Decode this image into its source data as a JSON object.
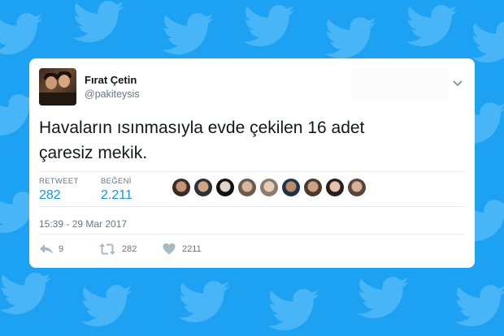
{
  "background": {
    "color": "#1da1f2",
    "pattern_icon": "twitter-bird-icon"
  },
  "tweet": {
    "author": {
      "display_name": "Fırat Çetin",
      "handle": "@pakiteysis"
    },
    "text_line1": "Havaların ısınmasıyla evde çekilen 16 adet",
    "text_line2": "çaresiz mekik.",
    "stats": {
      "retweet_label": "RETWEET",
      "retweet_count": "282",
      "like_label": "BEĞENİ",
      "like_count": "2.211"
    },
    "liker_avatar_count": 9,
    "timestamp": "15:39 - 29 Mar 2017",
    "actions": {
      "reply_icon": "reply-icon",
      "reply_count": "9",
      "retweet_icon": "retweet-icon",
      "retweet_count": "282",
      "like_icon": "heart-icon",
      "like_count": "2211"
    },
    "menu_icon": "chevron-down-icon"
  },
  "colors": {
    "accent": "#1b95e0",
    "muted": "#657786",
    "text": "#14171a",
    "icon": "#aab8c2"
  }
}
